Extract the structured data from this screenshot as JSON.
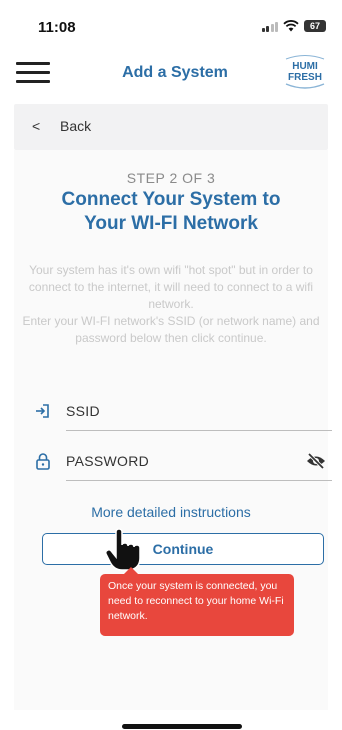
{
  "status_bar": {
    "time": "11:08",
    "battery": "67"
  },
  "header": {
    "title": "Add a System",
    "logo_line1": "HUMI",
    "logo_line2": "FRESH"
  },
  "back": {
    "label": "Back"
  },
  "step": {
    "label": "STEP 2 OF 3"
  },
  "title": {
    "line1": "Connect Your System to",
    "line2": "Your WI-FI Network"
  },
  "description": {
    "para1": "Your system has it's own wifi \"hot spot\" but in order to connect to the internet, it will need to connect to a wifi network.",
    "para2": "Enter your WI-FI network's SSID (or network name) and password below then click continue."
  },
  "fields": {
    "ssid_placeholder": "SSID",
    "password_placeholder": "PASSWORD"
  },
  "links": {
    "more_instructions": "More detailed instructions"
  },
  "buttons": {
    "continue": "Continue"
  },
  "tooltip": {
    "text": "Once your system is connected, you need to reconnect to your home Wi-Fi network."
  },
  "colors": {
    "accent": "#2c6ea6",
    "tooltip_bg": "#e8473d",
    "background": "#fafafa"
  }
}
